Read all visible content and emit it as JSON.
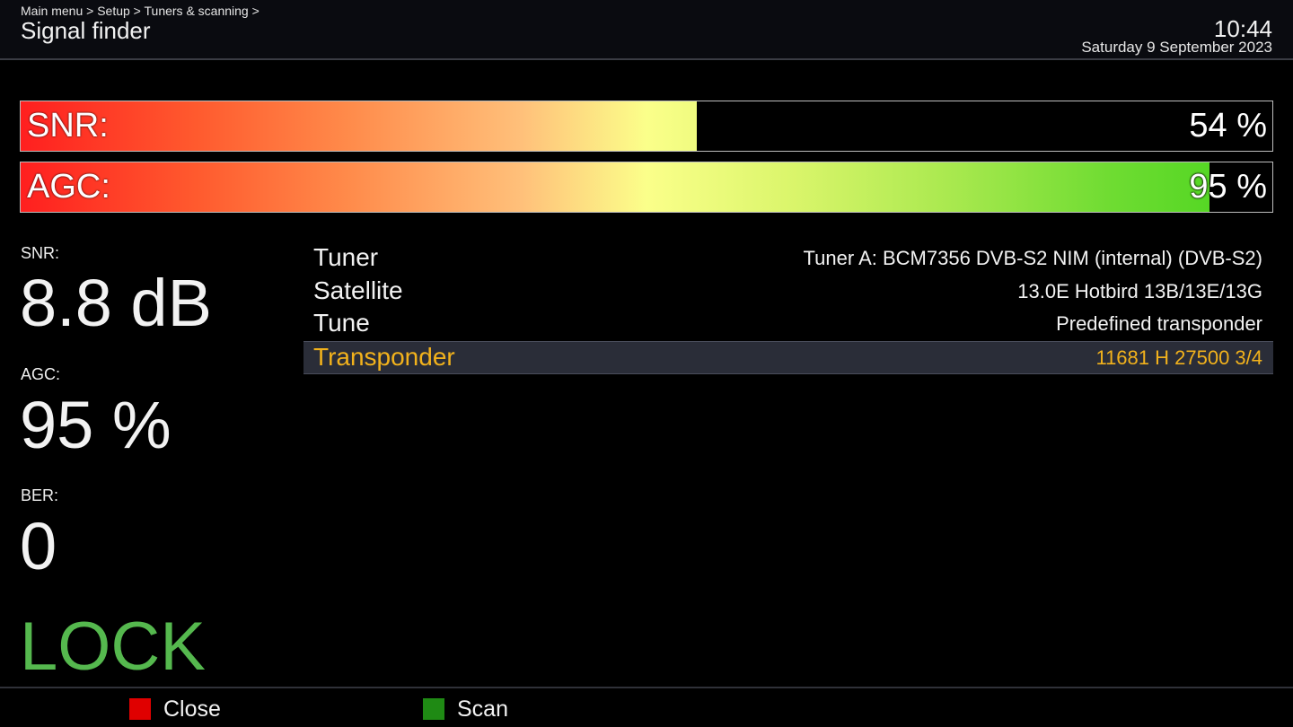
{
  "header": {
    "breadcrumb": "Main menu > Setup > Tuners & scanning >",
    "title": "Signal finder",
    "time": "10:44",
    "date": "Saturday  9 September 2023"
  },
  "bars": {
    "snr": {
      "label": "SNR:",
      "value_text": "54 %",
      "fraction": 0.54
    },
    "agc": {
      "label": "AGC:",
      "value_text": "95 %",
      "fraction": 0.95
    }
  },
  "readouts": {
    "snr": {
      "label": "SNR:",
      "value": "8.8 dB"
    },
    "agc": {
      "label": "AGC:",
      "value": "95 %"
    },
    "ber": {
      "label": "BER:",
      "value": "0"
    },
    "status": "LOCK"
  },
  "info": [
    {
      "key": "Tuner",
      "value": "Tuner A: BCM7356 DVB-S2 NIM (internal) (DVB-S2)"
    },
    {
      "key": "Satellite",
      "value": "13.0E Hotbird 13B/13E/13G"
    },
    {
      "key": "Tune",
      "value": "Predefined transponder"
    },
    {
      "key": "Transponder",
      "value": "11681 H 27500 3/4"
    }
  ],
  "footer": {
    "close": {
      "label": "Close",
      "color": "#e00000"
    },
    "scan": {
      "label": "Scan",
      "color": "#1f8a14"
    }
  },
  "colors": {
    "status": "#55b84e",
    "selection_text": "#f2b21c"
  }
}
